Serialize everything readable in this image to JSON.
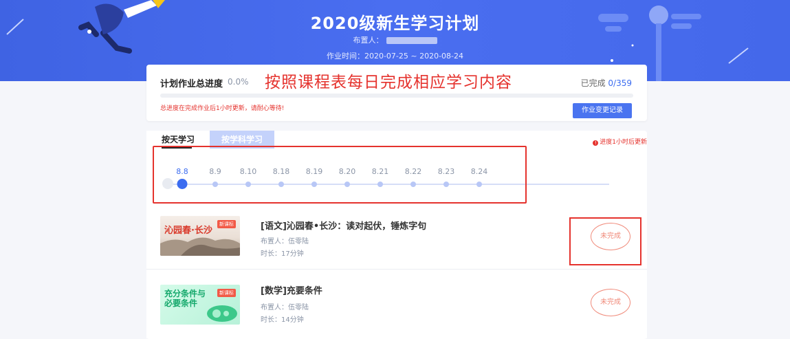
{
  "header": {
    "title": "2020级新生学习计划",
    "assigner_label": "布置人：",
    "work_time": "作业时间：2020-07-25 ~ 2020-08-24",
    "colors": {
      "banner": "#4468ea"
    }
  },
  "progress_card": {
    "label": "计划作业总进度",
    "percent": "0.0%",
    "overlay_text": "按照课程表每日完成相应学习内容",
    "done_label": "已完成",
    "done_count": "0/359",
    "notice": "总进度在完成作业后1小时更新，请耐心等待!",
    "change_button": "作业变更记录"
  },
  "tabs": {
    "by_day": "按天学习",
    "by_subject": "按学科学习",
    "refresh_note": "进度1小时后更新",
    "refresh_icon": "!"
  },
  "timeline": {
    "dates": [
      "8.8",
      "8.9",
      "8.10",
      "8.18",
      "8.19",
      "8.20",
      "8.21",
      "8.22",
      "8.23",
      "8.24"
    ],
    "active_index": 0
  },
  "lessons": [
    {
      "thumb_text": "沁园春·长沙",
      "badge": "新课标",
      "title": "[语文]沁园春•长沙：读对起伏，锤炼字句",
      "assigner": "布置人：伍零陆",
      "duration": "时长：17分钟",
      "status": "未完成"
    },
    {
      "thumb_text": "充分条件与必要条件",
      "badge": "新课标",
      "title": "[数学]充要条件",
      "assigner": "布置人：伍零陆",
      "duration": "时长：14分钟",
      "status": "未完成"
    }
  ],
  "colors": {
    "accent": "#3b6cf0",
    "annotation_red": "#e5322d",
    "status_orange": "#f08a7a"
  }
}
